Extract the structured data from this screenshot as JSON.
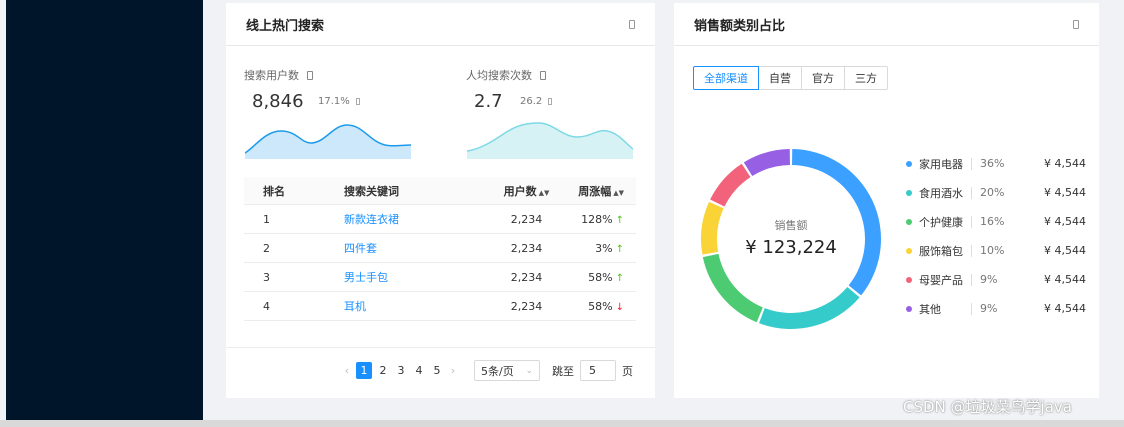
{
  "search_card": {
    "title": "线上热门搜索",
    "stats": [
      {
        "label": "搜索用户数",
        "value": "8,846",
        "pct": "17.1%"
      },
      {
        "label": "人均搜索次数",
        "value": "2.7",
        "pct": "26.2"
      }
    ],
    "table": {
      "headers": {
        "rank": "排名",
        "keyword": "搜索关键词",
        "users": "用户数",
        "change": "周涨幅"
      },
      "rows": [
        {
          "rank": "1",
          "keyword": "新款连衣裙",
          "users": "2,234",
          "change": "128%",
          "trend": "up"
        },
        {
          "rank": "2",
          "keyword": "四件套",
          "users": "2,234",
          "change": "3%",
          "trend": "up"
        },
        {
          "rank": "3",
          "keyword": "男士手包",
          "users": "2,234",
          "change": "58%",
          "trend": "up"
        },
        {
          "rank": "4",
          "keyword": "耳机",
          "users": "2,234",
          "change": "58%",
          "trend": "down"
        }
      ]
    },
    "pagination": {
      "pages": [
        "1",
        "2",
        "3",
        "4",
        "5"
      ],
      "current": "1",
      "page_size": "5条/页",
      "jump_label": "跳至",
      "jump_value": "5",
      "page_suffix": "页"
    }
  },
  "sales_card": {
    "title": "销售额类别占比",
    "tabs": [
      "全部渠道",
      "自营",
      "官方",
      "三方"
    ],
    "active_tab": "全部渠道",
    "center_label": "销售额",
    "center_value": "¥ 123,224"
  },
  "chart_data": {
    "type": "pie",
    "title": "",
    "categories": [
      "家用电器",
      "食用酒水",
      "个护健康",
      "服饰箱包",
      "母婴产品",
      "其他"
    ],
    "values": [
      36,
      20,
      16,
      10,
      9,
      9
    ],
    "pct_labels": [
      "36%",
      "20%",
      "16%",
      "10%",
      "9%",
      "9%"
    ],
    "amounts": [
      "¥ 4,544",
      "¥ 4,544",
      "¥ 4,544",
      "¥ 4,544",
      "¥ 4,544",
      "¥ 4,544"
    ],
    "colors": [
      "#3ba0ff",
      "#36cbcb",
      "#4dcb73",
      "#fad337",
      "#f2637b",
      "#975fe4"
    ]
  },
  "sparkline_colors": {
    "users": "#1d9bea",
    "per_user": "#7dd9e6"
  },
  "watermark": "CSDN @垃圾菜鸟学java"
}
